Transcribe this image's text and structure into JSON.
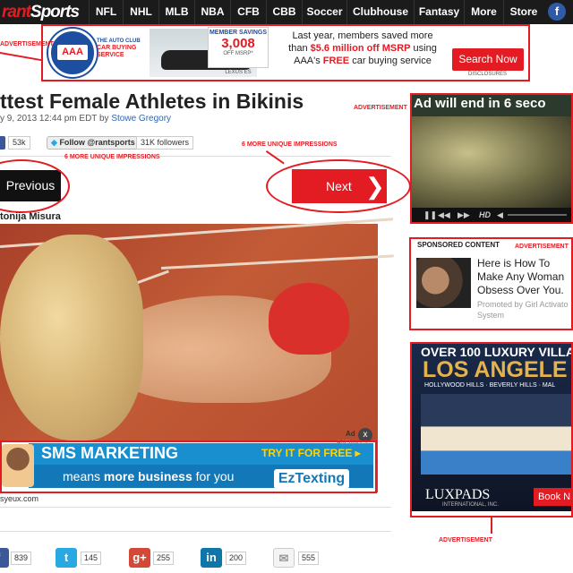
{
  "nav": {
    "logo_red": "rant",
    "logo_white": "Sports",
    "items": [
      "NFL",
      "NHL",
      "MLB",
      "NBA",
      "CFB",
      "CBB",
      "Soccer",
      "Clubhouse",
      "Fantasy",
      "More",
      "Store"
    ],
    "facebook_icon": "f"
  },
  "annotations": {
    "advertisement": "ADVERTISEMENT",
    "impressions": "6 MORE UNIQUE IMPRESSIONS",
    "color": "#e31c23"
  },
  "top_ad": {
    "aaa": "AAA",
    "auto_club": "THE AUTO CLUB",
    "car_buying": "CAR BUYING SERVICE",
    "member_savings": "MEMBER SAVINGS",
    "amount": "3,008",
    "off_msrp": "OFF MSRP*",
    "car_model": "LEXUS ES",
    "msg_line1": "Last year, members saved more",
    "msg_than": "than ",
    "msg_amount": "$5.6 million off MSRP",
    "msg_using": " using",
    "msg_aaa": "AAA's ",
    "msg_free": "FREE",
    "msg_end": " car buying service",
    "cta": "Search Now",
    "disclosures": "DISCLOSURES"
  },
  "article": {
    "title": "ttest Female Athletes in Bikinis",
    "date": "y 9, 2013 12:44 pm EDT by ",
    "author": "Stowe Gregory",
    "fb_count": "53k",
    "follow_label": "Follow @rantsports",
    "followers": "31K followers",
    "prev": "Previous",
    "next": "Next",
    "photo_credit": "tonija Misura",
    "photo_source": "syeux.com"
  },
  "sms_ad": {
    "title": "SMS MARKETING",
    "sub_prefix": "means ",
    "sub_bold": "more business",
    "sub_suffix": " for you",
    "try": "TRY IT FOR FREE ▸",
    "brand": "EzTexting",
    "ad_label": "Ad",
    "close": "x",
    "adchoices": "AdChoices"
  },
  "share": [
    {
      "icon": "f",
      "count": "839",
      "color": "#3b5998"
    },
    {
      "icon": "t",
      "count": "145",
      "color": "#29a9e1"
    },
    {
      "icon": "g+",
      "count": "255",
      "color": "#d34836"
    },
    {
      "icon": "in",
      "count": "200",
      "color": "#0e76a8"
    },
    {
      "icon": "✉",
      "count": "555",
      "color": "#cccccc"
    }
  ],
  "video_ad": {
    "countdown": "Ad will end in 6 seco",
    "hd": "HD"
  },
  "sponsored": {
    "label": "SPONSORED CONTENT",
    "headline": "Here is How To Make Any Woman Obsess Over You.",
    "promoted": "Promoted by Girl Activato System"
  },
  "lux_ad": {
    "top": "OVER 100 LUXURY VILLA",
    "city": "LOS ANGELE",
    "sub": "HOLLYWOOD HILLS · BEVERLY HILLS · MAL",
    "brand": "LUXPADS",
    "inc": "INTERNATIONAL, INC.",
    "cta": "Book N"
  }
}
